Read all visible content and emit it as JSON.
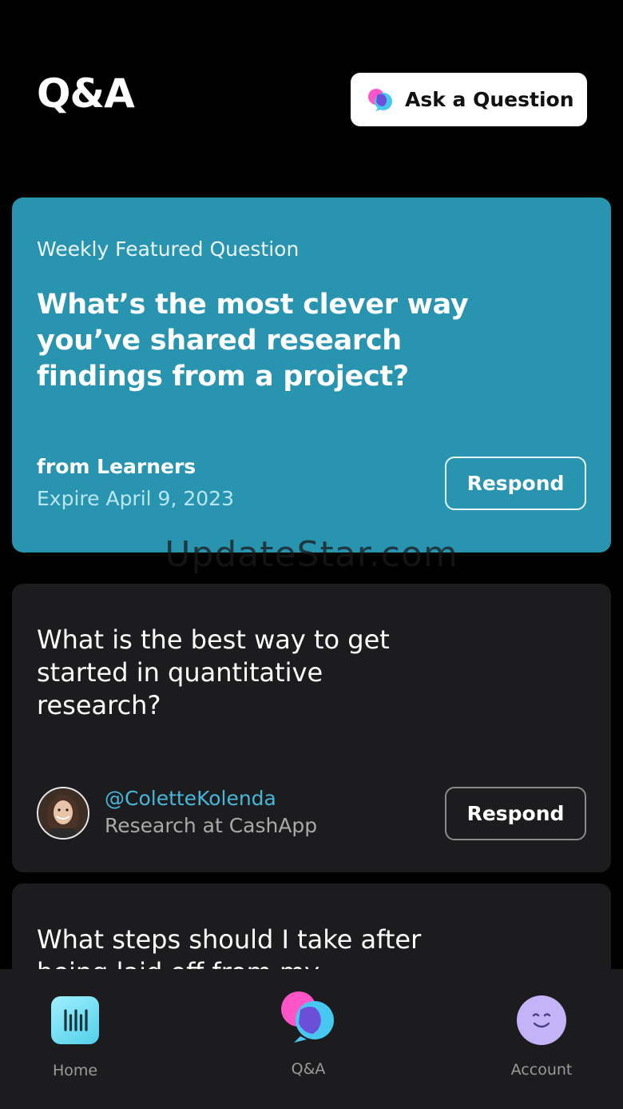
{
  "header": {
    "title": "Q&A",
    "ask_button_label": "Ask a Question"
  },
  "featured": {
    "kicker": "Weekly Featured Question",
    "question": "What’s the most clever way you’ve shared research findings from a project?",
    "from": "from Learners",
    "expire": "Expire April 9, 2023",
    "respond_label": "Respond"
  },
  "questions": [
    {
      "question": "What is the best way to get started in quantitative research?",
      "author_handle": "@ColetteKolenda",
      "author_role": "Research at CashApp",
      "respond_label": "Respond"
    },
    {
      "question": "What steps should I take after being laid off from my"
    }
  ],
  "watermark": "UpdateStar.com",
  "tabbar": {
    "items": [
      {
        "label": "Home",
        "icon": "home-icon"
      },
      {
        "label": "Q&A",
        "icon": "qa-chat-icon"
      },
      {
        "label": "Account",
        "icon": "smile-face-icon"
      }
    ]
  },
  "colors": {
    "featured_bg": "#2894b0",
    "card_bg": "#1c1c1e",
    "handle": "#47b6d8",
    "home_icon": "#6bd9ee",
    "account_icon": "#c4b3f7",
    "chat_pink": "#ff55c8",
    "chat_blue": "#48c8f0",
    "chat_purple": "#6b4fd8"
  }
}
